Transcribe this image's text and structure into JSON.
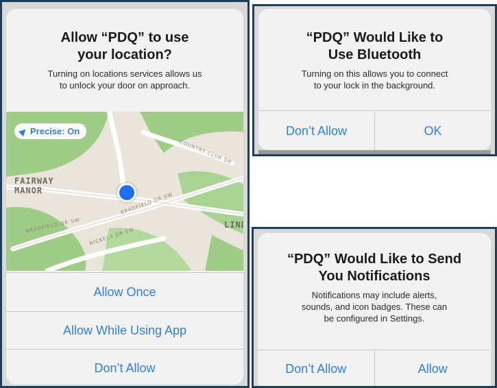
{
  "location_prompt": {
    "title": "Allow “PDQ” to use your location?",
    "title_line1": "Allow “PDQ” to use",
    "title_line2": "your location?",
    "body_line1": "Turning on locations services allows us",
    "body_line2": "to unlock your door on approach.",
    "precise_label": "Precise: On",
    "map_labels": {
      "neighborhood_line1": "FAIRWAY",
      "neighborhood_line2": "MANOR",
      "edge_label": "LIND",
      "street_country_club": "COUNTRY CLUB DR",
      "street_bradfield_1": "BRADFIELD DR SW",
      "street_bradfield_2": "BRADFIELD DR SW",
      "street_nickels": "NICKELS DR SW"
    },
    "buttons": [
      "Allow Once",
      "Allow While Using App",
      "Don’t Allow"
    ]
  },
  "bluetooth_prompt": {
    "title_line1": "“PDQ” Would Like to",
    "title_line2": "Use Bluetooth",
    "body_line1": "Turning on this allows you to connect",
    "body_line2": "to your lock in the background.",
    "buttons": [
      "Don’t Allow",
      "OK"
    ]
  },
  "notifications_prompt": {
    "title_line1": "“PDQ” Would Like to Send",
    "title_line2": "You Notifications",
    "body_line1": "Notifications may include alerts,",
    "body_line2": "sounds, and icon badges. These can",
    "body_line3": "be configured in Settings.",
    "buttons": [
      "Don’t Allow",
      "Allow"
    ]
  },
  "colors": {
    "panel_border": "#1f3d5c",
    "button_text": "#2f7fe0",
    "location_pin": "#1e6ff0",
    "map_green": "#9fcd88"
  },
  "icons": {
    "precise": "location-arrow-icon",
    "current_location": "location-dot-icon"
  }
}
